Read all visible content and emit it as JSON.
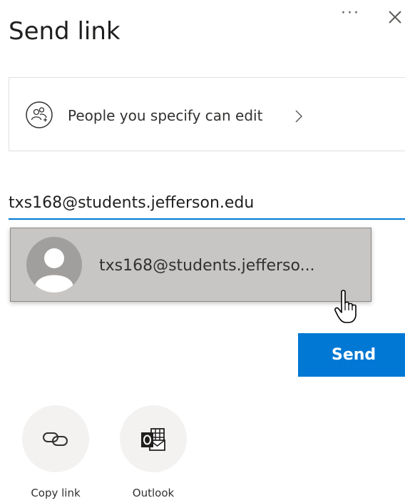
{
  "dialog": {
    "title": "Send link",
    "more_icon": "more-options-icon",
    "close_icon": "close-icon"
  },
  "permission": {
    "icon": "people-icon",
    "label": "People you specify can edit",
    "chevron_icon": "chevron-right-icon"
  },
  "recipient": {
    "value": "txs168@students.jefferson.edu"
  },
  "suggestion": {
    "avatar_icon": "person-avatar-icon",
    "text": "txs168@students.jefferso..."
  },
  "send_button": {
    "label": "Send",
    "color": "#0078d4"
  },
  "share_options": [
    {
      "label": "Copy link",
      "icon": "link-icon"
    },
    {
      "label": "Outlook",
      "icon": "outlook-icon"
    }
  ]
}
